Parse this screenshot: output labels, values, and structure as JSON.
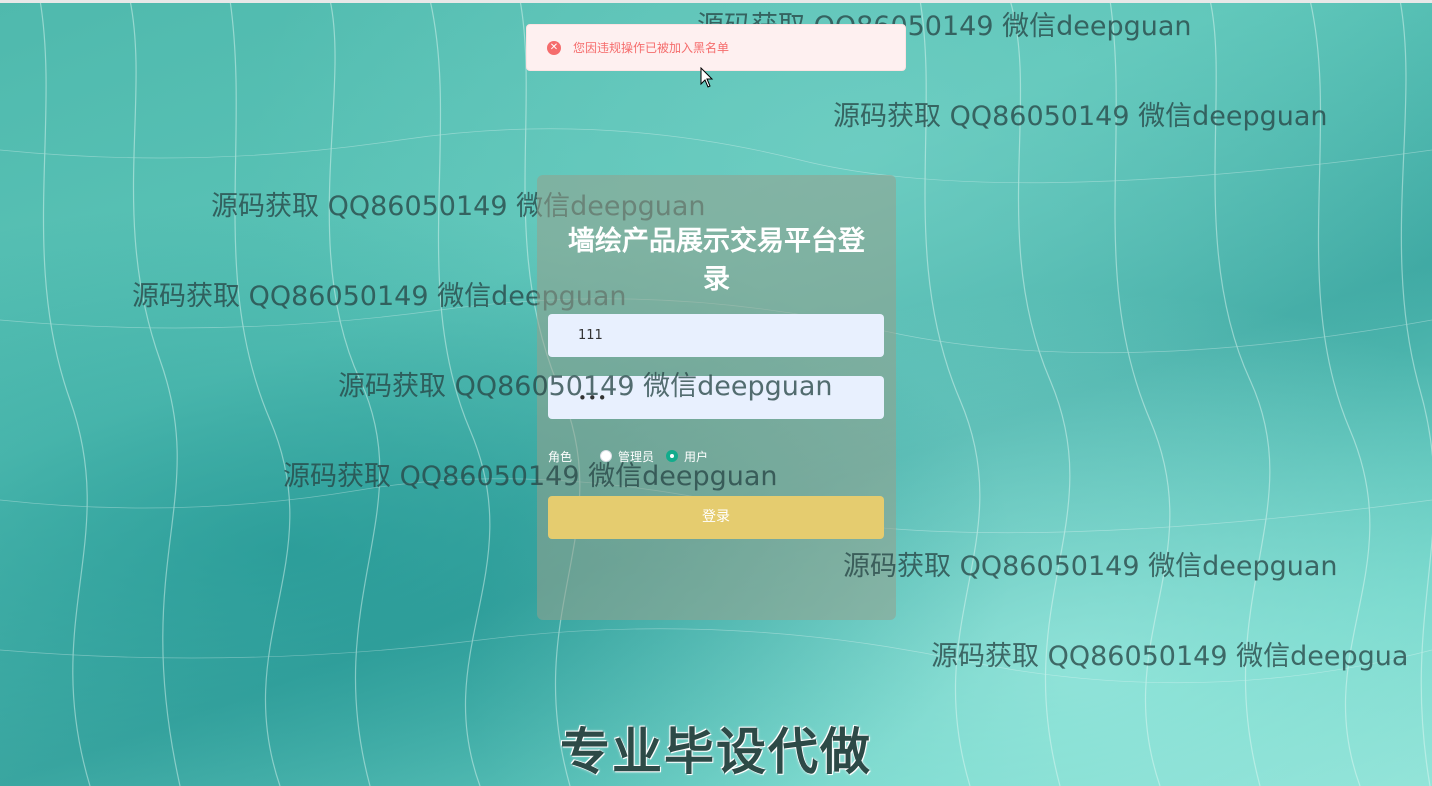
{
  "toast": {
    "icon": "error-circle-icon",
    "message": "您因违规操作已被加入黑名单",
    "color": "#f56c6c"
  },
  "watermarks": [
    "源码获取 QQ86050149 微信deepguan",
    "源码获取 QQ86050149 微信deepguan",
    "源码获取 QQ86050149 微信deepguan",
    "源码获取 QQ86050149 微信deepguan",
    "源码获取 QQ86050149 微信deepguan",
    "源码获取 QQ86050149 微信deepguan",
    "源码获取 QQ86050149 微信deepguan",
    "源码获取 QQ86050149 微信deepgua"
  ],
  "login": {
    "title": "墙绘产品展示交易平台登录",
    "username_value": "111",
    "password_value": "•••",
    "role_label": "角色",
    "roles": [
      {
        "label": "管理员",
        "checked": false
      },
      {
        "label": "用户",
        "checked": true
      }
    ],
    "submit_label": "登录",
    "accent_color": "#13ac8c",
    "button_color": "#e5cc6f"
  },
  "footer": {
    "banner": "专业毕设代做"
  }
}
